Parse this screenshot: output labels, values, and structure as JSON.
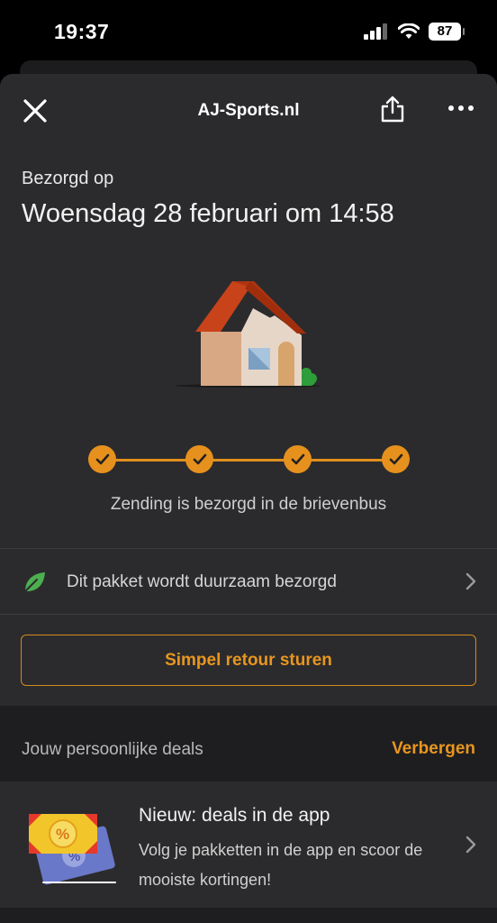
{
  "status_bar": {
    "time": "19:37",
    "battery": "87",
    "icons": [
      "signal-icon",
      "wifi-icon",
      "battery-icon"
    ]
  },
  "nav": {
    "title": "AJ-Sports.nl",
    "close_icon": "close-icon",
    "share_icon": "share-icon",
    "more_icon": "more-icon"
  },
  "delivery": {
    "label": "Bezorgd op",
    "datetime": "Woensdag 28 februari om 14:58",
    "illustration": "house-illustration",
    "steps_total": 4,
    "steps_completed": 4,
    "status": "Zending is bezorgd in de brievenbus"
  },
  "sustainability": {
    "label": "Dit pakket wordt duurzaam bezorgd",
    "icon": "leaf-icon"
  },
  "return_button": {
    "label": "Simpel retour sturen"
  },
  "deals": {
    "title": "Jouw persoonlijke deals",
    "hide_label": "Verbergen",
    "card": {
      "title": "Nieuw: deals in de app",
      "body": "Volg je pakketten in de app en scoor de mooiste kortingen!",
      "icon": "coupon-icon"
    }
  },
  "colors": {
    "accent": "#e8961f",
    "sheet_bg": "#2b2b2d",
    "section_bg": "#1e1e20",
    "leaf": "#4caf50"
  }
}
